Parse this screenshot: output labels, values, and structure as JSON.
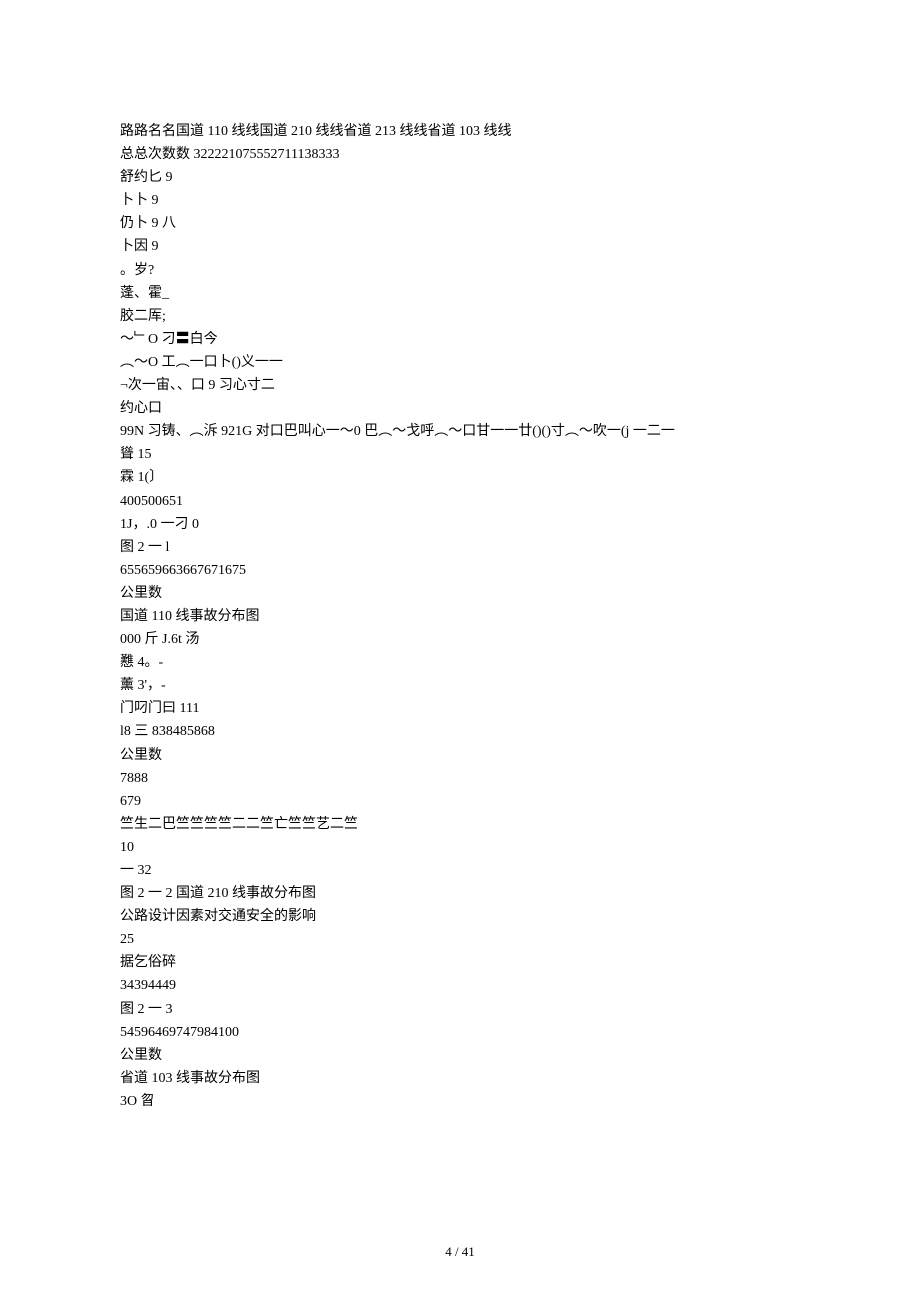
{
  "lines": [
    "路路名名国道 110 线线国道 210 线线省道 213 线线省道 103 线线",
    "总总次数数 322221075552711138333",
    "舒约匕 9",
    "卜卜 9",
    "仍卜 9 八",
    "卜因 9",
    "。岁?",
    "蓬、霍_",
    "胶二厍;",
    "〜﹂O 刁〓白今",
    "︵〜O 工︵一口卜()义一一",
    "¬次一宙、、口 9 习心寸二",
    "约心口",
    "99N 习铸、︵泝 921G 对口巴叫心一〜0 巴︵〜戈呼︵〜口甘一一廿()()寸︵〜吹一(j 一二一",
    "聳 15",
    "霖 1(〕",
    "400500651",
    "1J，.0 一刁 0",
    "图 2 一 l",
    "655659663667671675",
    "公里数",
    "国道 110 线事故分布图",
    "000 斤 J.6t 汤",
    "戁 4。-",
    "薰 3'，-",
    "门叼门曰 111",
    "l8 三 838485868",
    "公里数",
    "7888",
    "679",
    "竺生二巴竺竺竺竺二二竺亡竺竺艺二竺",
    "10",
    "一 32",
    "图 2 一 2 国道 210 线事故分布图",
    "公路设计因素对交通安全的影响",
    "25",
    "据乞俗碎",
    "34394449",
    "图 2 一 3",
    "54596469747984100",
    "公里数",
    "省道 103 线事故分布图",
    "3O 曶"
  ],
  "pageNumber": "4  / 41"
}
